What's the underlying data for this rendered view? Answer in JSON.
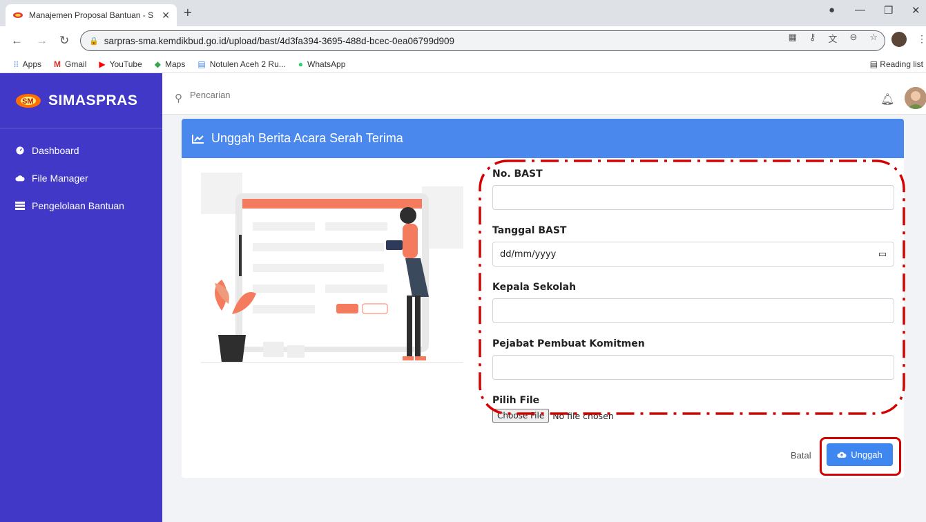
{
  "browser": {
    "tab_title": "Manajemen Proposal Bantuan - S",
    "url": "sarpras-sma.kemdikbud.go.id/upload/bast/4d3fa394-3695-488d-bcec-0ea06799d909",
    "bookmarks": [
      "Apps",
      "Gmail",
      "YouTube",
      "Maps",
      "Notulen Aceh 2 Ru...",
      "WhatsApp"
    ],
    "reading_list": "Reading list"
  },
  "sidebar": {
    "brand": "SIMASPRAS",
    "items": [
      {
        "label": "Dashboard",
        "icon": "dashboard-icon"
      },
      {
        "label": "File Manager",
        "icon": "cloud-icon"
      },
      {
        "label": "Pengelolaan Bantuan",
        "icon": "list-icon"
      }
    ]
  },
  "topbar": {
    "search_placeholder": "Pencarian"
  },
  "card": {
    "title": "Unggah Berita Acara Serah Terima",
    "fields": {
      "no_bast": {
        "label": "No. BAST",
        "value": ""
      },
      "tanggal_bast": {
        "label": "Tanggal BAST",
        "value": "dd/mm/yyyy"
      },
      "kepala_sekolah": {
        "label": "Kepala Sekolah",
        "value": ""
      },
      "ppk": {
        "label": "Pejabat Pembuat Komitmen",
        "value": ""
      },
      "file": {
        "label": "Pilih File",
        "button": "Choose File",
        "status": "No file chosen"
      }
    },
    "cancel_label": "Batal",
    "submit_label": "Unggah"
  },
  "colors": {
    "sidebar": "#4138c8",
    "header": "#4a88ed",
    "annotation": "#d50000"
  }
}
